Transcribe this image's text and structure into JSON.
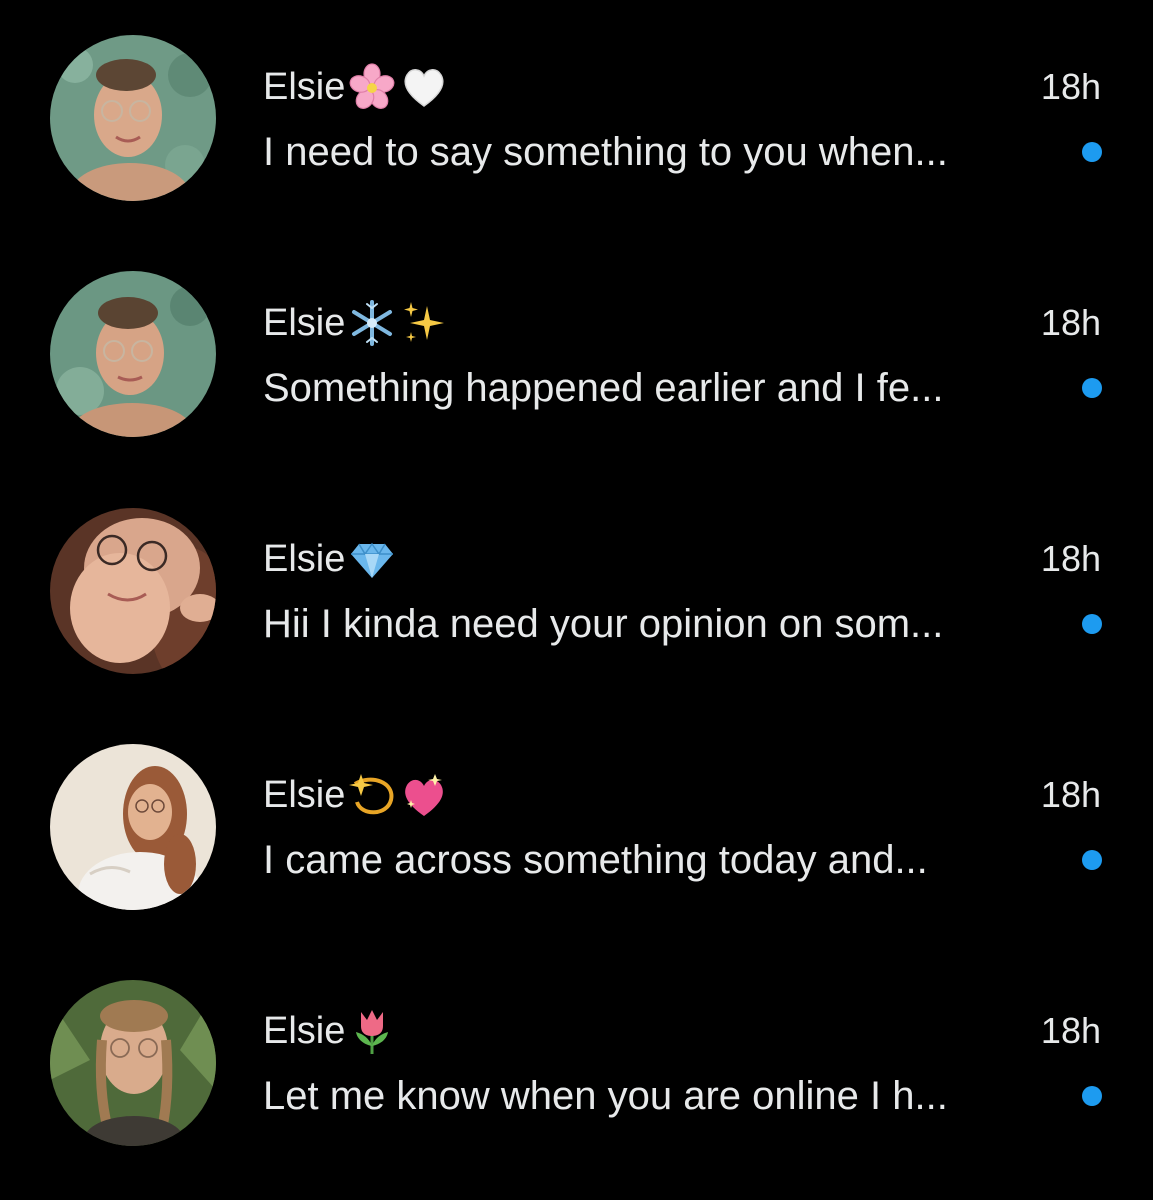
{
  "colors": {
    "background": "#000000",
    "text": "#e7e9ea",
    "unread_dot": "#1d9bf0"
  },
  "conversations": [
    {
      "name": "Elsie",
      "emojis": [
        "cherry-blossom-emoji",
        "white-heart-emoji"
      ],
      "time": "18h",
      "preview": "I need to say something to you when...",
      "unread": true
    },
    {
      "name": "Elsie",
      "emojis": [
        "snowflake-emoji",
        "sparkles-emoji"
      ],
      "time": "18h",
      "preview": "Something happened earlier and I fe...",
      "unread": true
    },
    {
      "name": "Elsie",
      "emojis": [
        "gem-emoji"
      ],
      "time": "18h",
      "preview": "Hii I kinda need your opinion on som...",
      "unread": true
    },
    {
      "name": "Elsie",
      "emojis": [
        "dizzy-emoji",
        "sparkling-heart-emoji"
      ],
      "time": "18h",
      "preview": "I came across something today and...",
      "unread": true
    },
    {
      "name": "Elsie",
      "emojis": [
        "tulip-emoji"
      ],
      "time": "18h",
      "preview": "Let me know when you are online I h...",
      "unread": true
    }
  ]
}
